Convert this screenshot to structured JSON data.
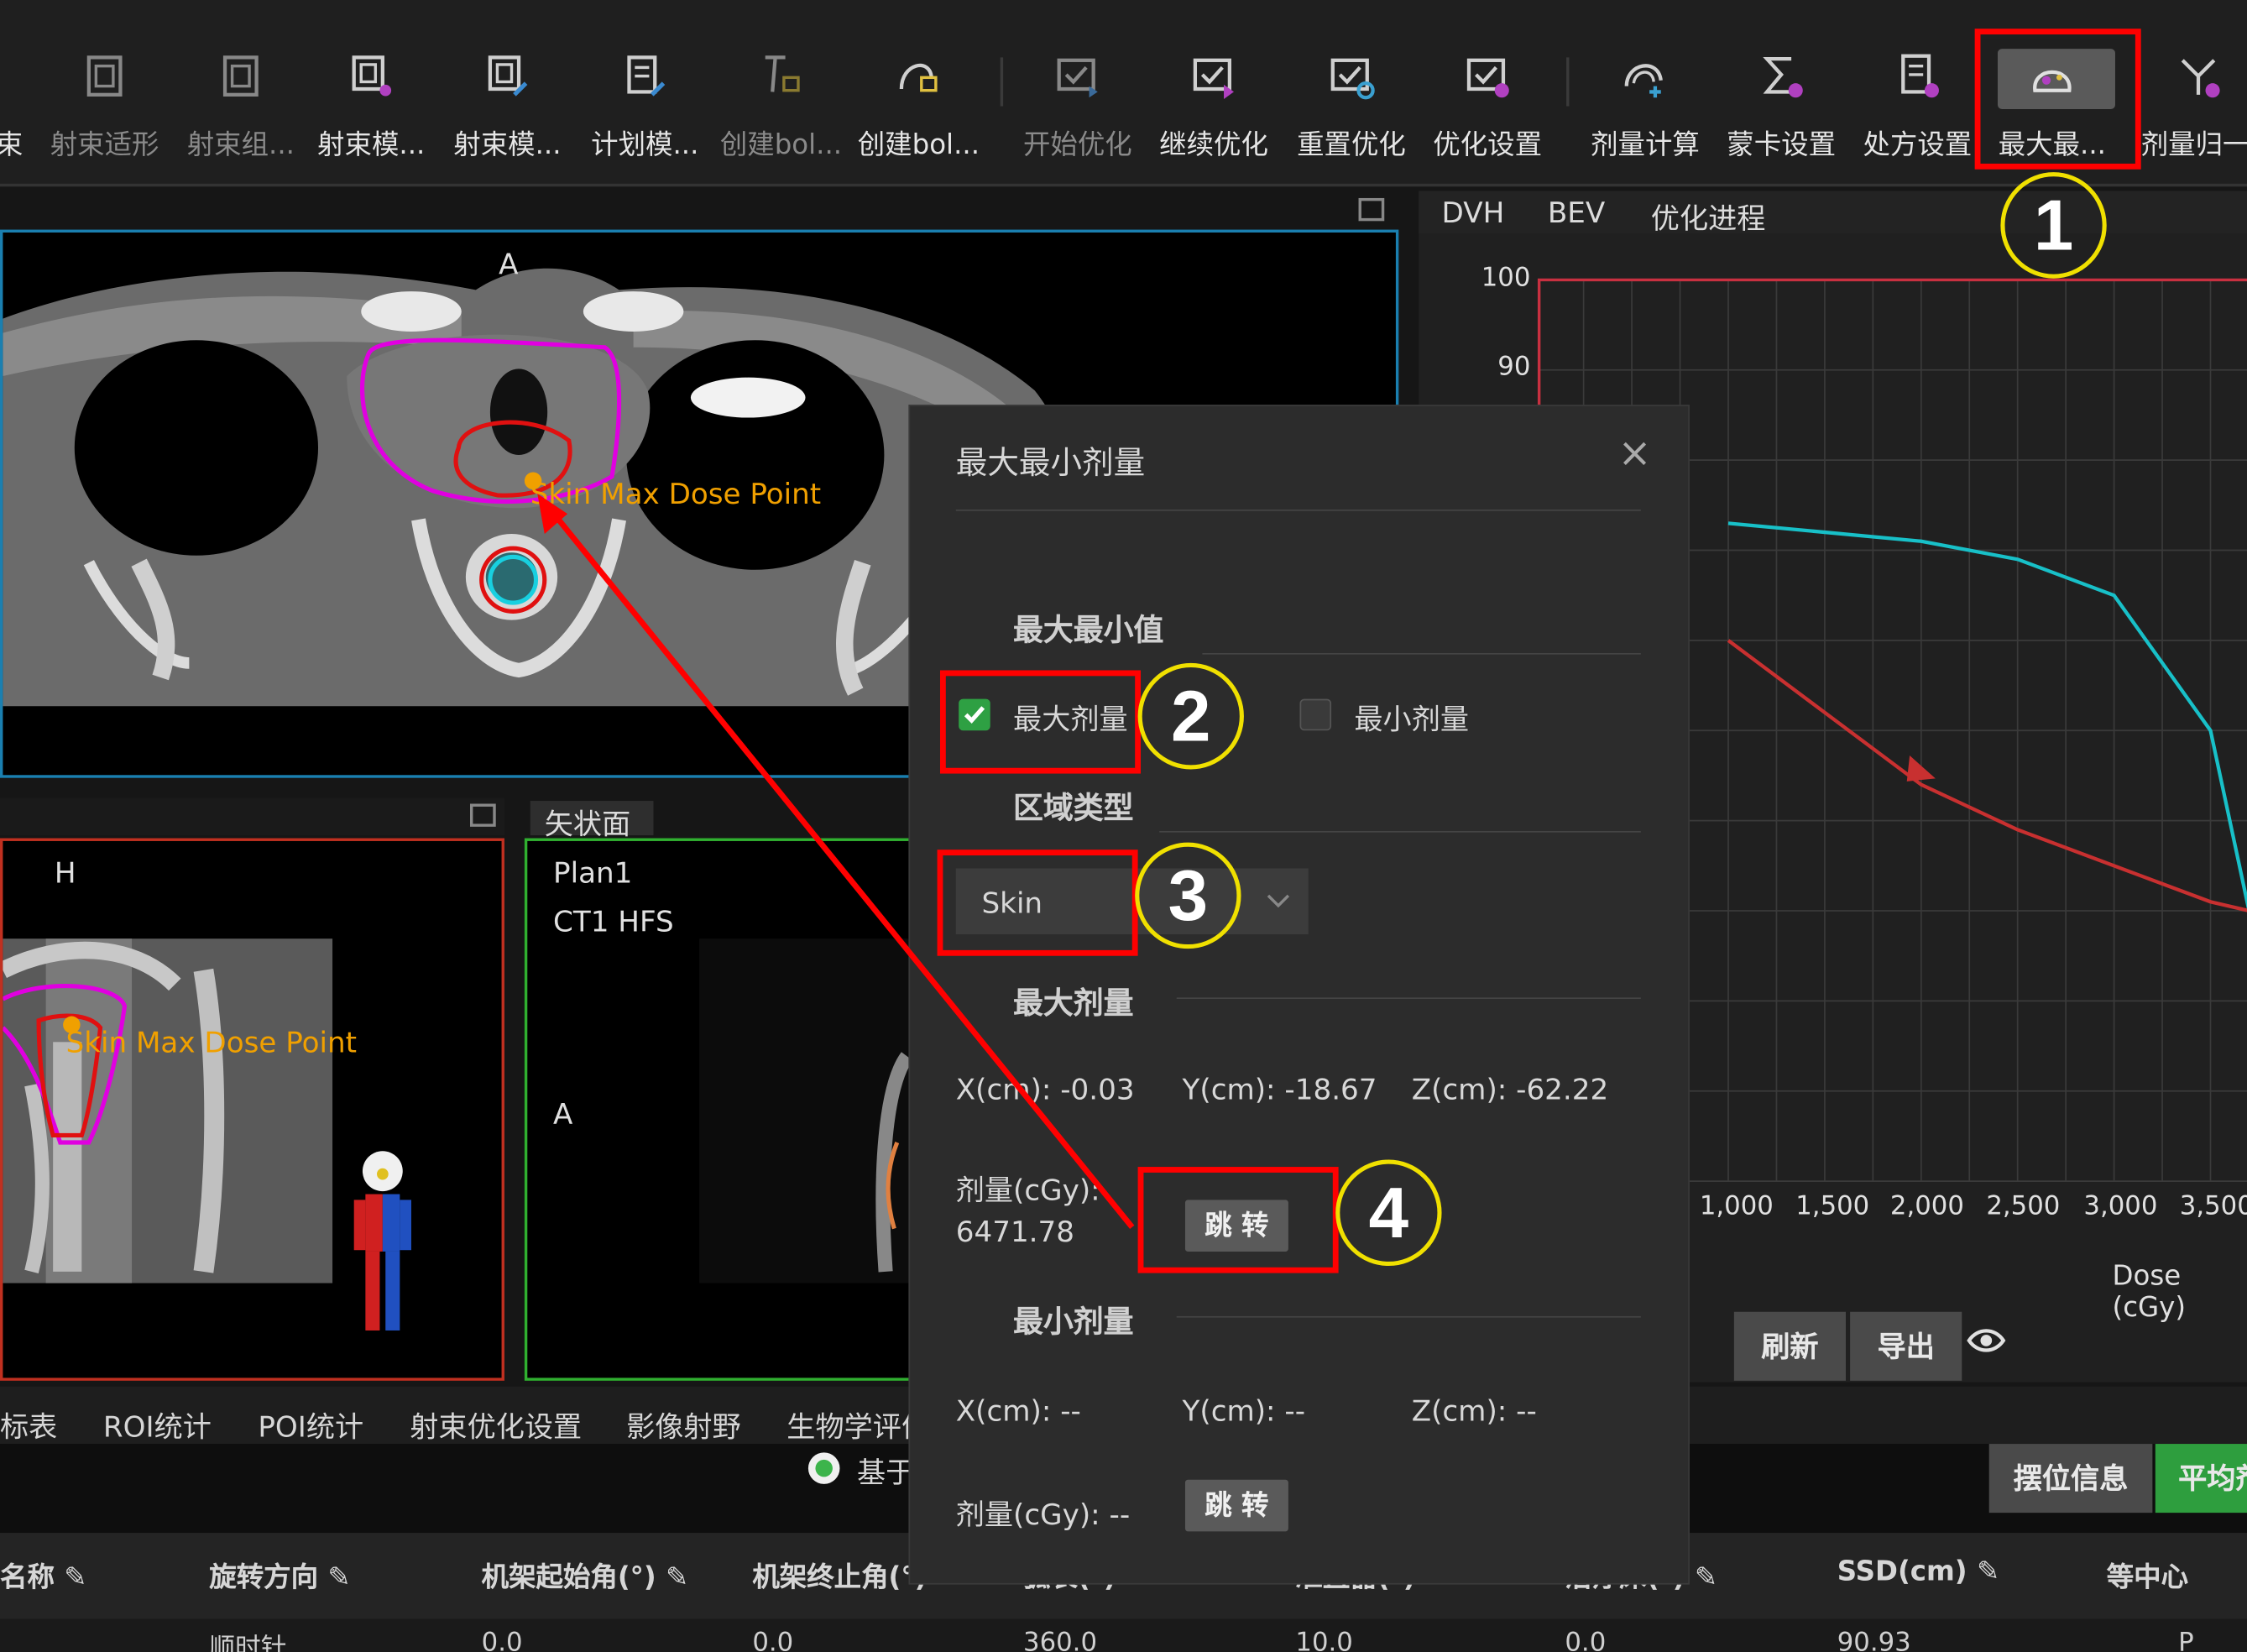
{
  "toolbar": {
    "items": [
      {
        "label": "束",
        "disabled": false
      },
      {
        "label": "射束适形",
        "disabled": true
      },
      {
        "label": "射束组...",
        "disabled": true
      },
      {
        "label": "射束模...",
        "disabled": false
      },
      {
        "label": "射束模...",
        "disabled": false
      },
      {
        "label": "计划模...",
        "disabled": false
      },
      {
        "label": "创建bol...",
        "disabled": true
      },
      {
        "label": "创建bol...",
        "disabled": false
      },
      {
        "label": "开始优化",
        "disabled": true
      },
      {
        "label": "继续优化",
        "disabled": false
      },
      {
        "label": "重置优化",
        "disabled": false
      },
      {
        "label": "优化设置",
        "disabled": false
      },
      {
        "label": "剂量计算",
        "disabled": false
      },
      {
        "label": "蒙卡设置",
        "disabled": false
      },
      {
        "label": "处方设置",
        "disabled": false
      },
      {
        "label": "最大最...",
        "disabled": false
      },
      {
        "label": "剂量归一",
        "disabled": false
      }
    ]
  },
  "axial_view": {
    "orientation_label": "A",
    "poi_label": "Skin Max Dose Point"
  },
  "coronal_view": {
    "orientation_label": "H",
    "poi_label": "Skin Max Dose Point"
  },
  "sagittal_view": {
    "tab_label": "矢状面",
    "plan_name": "Plan1",
    "ct_info": "CT1 HFS",
    "orientation_label": "A"
  },
  "right_tabs": [
    "DVH",
    "BEV",
    "优化进程"
  ],
  "dvh_chart": {
    "y_ticks": [
      "100",
      "90"
    ],
    "x_ticks": [
      "1,000",
      "1,500",
      "2,000",
      "2,500",
      "3,000",
      "3,500"
    ],
    "x_label": "Dose (cGy)",
    "refresh_label": "刷新",
    "export_label": "导出"
  },
  "chart_data": {
    "type": "line",
    "title": "",
    "xlabel": "Dose (cGy)",
    "ylabel": "",
    "ylim": [
      0,
      100
    ],
    "series": [
      {
        "color": "#18c0c8",
        "x": [
          1000,
          1500,
          2000,
          2500,
          3000,
          3500,
          3700
        ],
        "y": [
          73,
          72,
          71,
          69,
          65,
          50,
          30
        ]
      },
      {
        "color": "#c83030",
        "x": [
          1000,
          1500,
          2000,
          2500,
          3000,
          3500,
          3700
        ],
        "y": [
          60,
          52,
          44,
          39,
          35,
          31,
          30
        ]
      }
    ]
  },
  "dialog": {
    "title": "最大最小剂量",
    "close_symbol": "×",
    "section_extreme": "最大最小值",
    "max_checkbox_label": "最大剂量",
    "max_checked": true,
    "min_checkbox_label": "最小剂量",
    "min_checked": false,
    "section_region": "区域类型",
    "region_value": "Skin",
    "section_max": "最大剂量",
    "max_x": "X(cm): -0.03",
    "max_y": "Y(cm): -18.67",
    "max_z": "Z(cm): -62.22",
    "max_dose_label": "剂量(cGy):",
    "max_dose_value": "6471.78",
    "jump_label": "跳 转",
    "section_min": "最小剂量",
    "min_x": "X(cm): --",
    "min_y": "Y(cm): --",
    "min_z": "Z(cm): --",
    "min_dose": "剂量(cGy): --",
    "jump2_label": "跳 转"
  },
  "bottom_tabs": [
    "标表",
    "ROI统计",
    "POI统计",
    "射束优化设置",
    "影像射野",
    "生物学评价"
  ],
  "radio_label": "基于",
  "right_buttons": {
    "setup": "摆位信息",
    "avg": "平均剂"
  },
  "table": {
    "headers": [
      "名称",
      "旋转方向",
      "机架起始角(°)",
      "机架终止角(°)",
      "弧长(°)",
      "准直器(°)",
      "治疗床(°)",
      "SSD(cm)",
      "等中心"
    ],
    "row": [
      "",
      "顺时针",
      "0.0",
      "0.0",
      "360.0",
      "10.0",
      "0.0",
      "90.93",
      "P"
    ]
  },
  "annotations": [
    "1",
    "2",
    "3",
    "4"
  ],
  "colors": {
    "highlight": "#ff0000",
    "circle": "#f0e000",
    "accent_green": "#3cb44b",
    "poi": "#f0a000"
  }
}
